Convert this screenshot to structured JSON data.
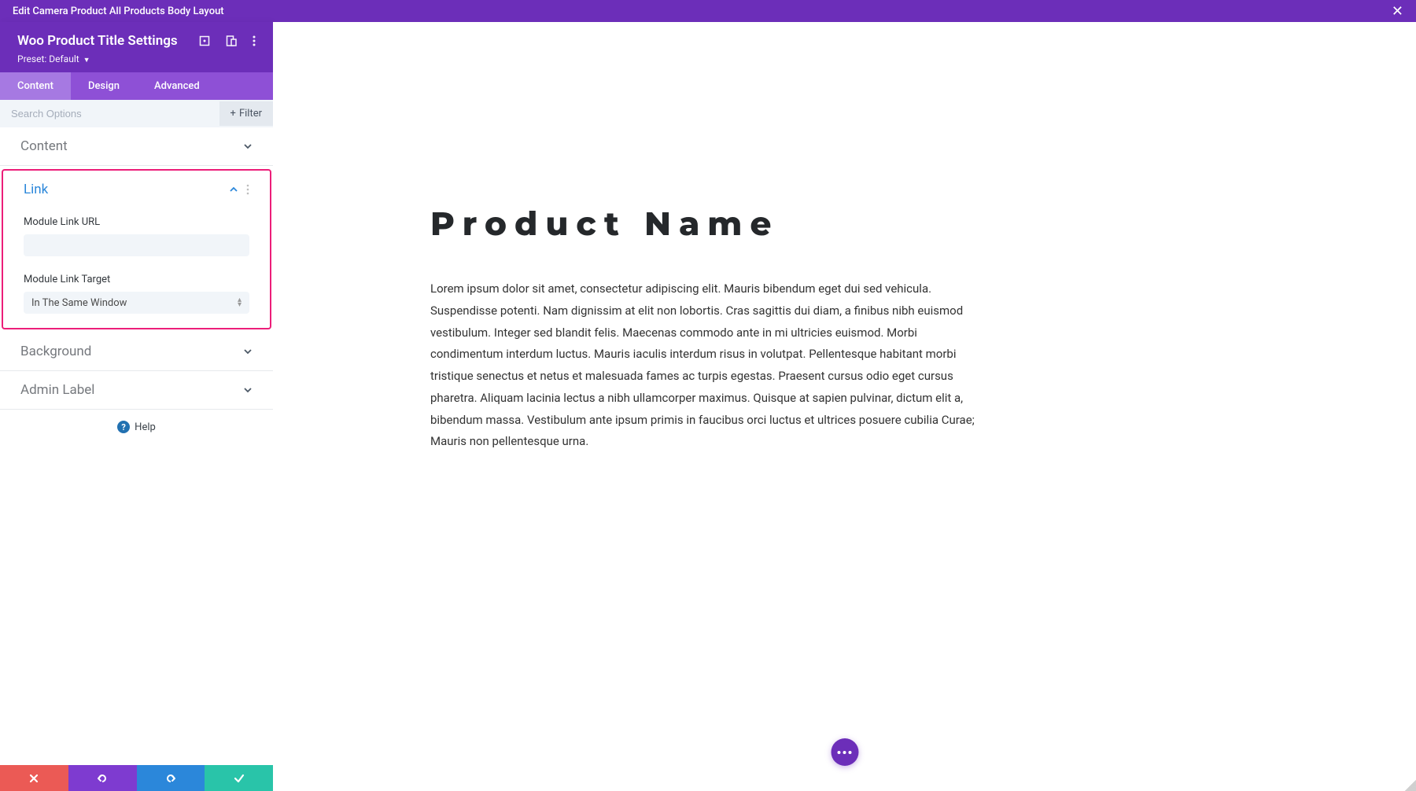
{
  "topBar": {
    "title": "Edit Camera Product All Products Body Layout"
  },
  "header": {
    "title": "Woo Product Title Settings",
    "presetLabel": "Preset:",
    "presetValue": "Default"
  },
  "tabs": {
    "content": "Content",
    "design": "Design",
    "advanced": "Advanced"
  },
  "search": {
    "placeholder": "Search Options",
    "filterLabel": "Filter"
  },
  "sections": {
    "content": "Content",
    "link": {
      "title": "Link",
      "urlLabel": "Module Link URL",
      "urlValue": "",
      "targetLabel": "Module Link Target",
      "targetValue": "In The Same Window"
    },
    "background": "Background",
    "adminLabel": "Admin Label"
  },
  "help": {
    "label": "Help"
  },
  "preview": {
    "title": "Product Name",
    "description": "Lorem ipsum dolor sit amet, consectetur adipiscing elit. Mauris bibendum eget dui sed vehicula. Suspendisse potenti. Nam dignissim at elit non lobortis. Cras sagittis dui diam, a finibus nibh euismod vestibulum. Integer sed blandit felis. Maecenas commodo ante in mi ultricies euismod. Morbi condimentum interdum luctus. Mauris iaculis interdum risus in volutpat. Pellentesque habitant morbi tristique senectus et netus et malesuada fames ac turpis egestas. Praesent cursus odio eget cursus pharetra. Aliquam lacinia lectus a nibh ullamcorper maximus. Quisque at sapien pulvinar, dictum elit a, bibendum massa. Vestibulum ante ipsum primis in faucibus orci luctus et ultrices posuere cubilia Curae; Mauris non pellentesque urna."
  }
}
